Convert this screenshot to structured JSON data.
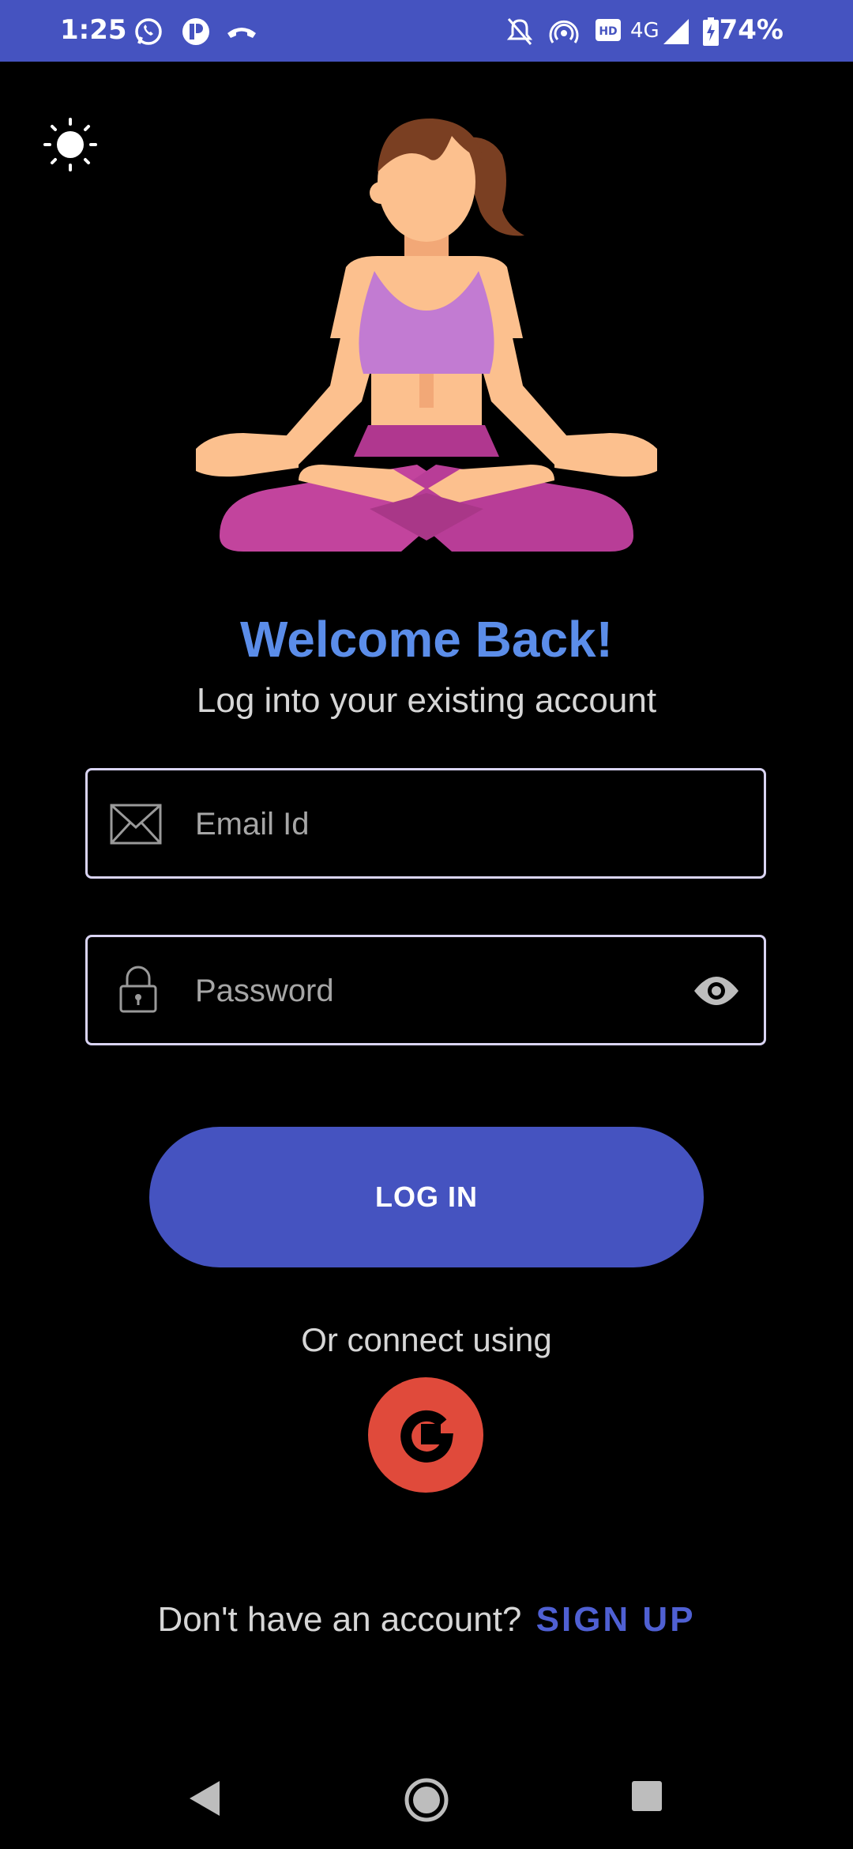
{
  "status_bar": {
    "time": "1:25",
    "network": "4G",
    "battery": "74%",
    "icons": [
      "whatsapp-icon",
      "app-icon",
      "missed-call-icon",
      "mute-icon",
      "hotspot-icon",
      "hd-icon",
      "signal-icon",
      "battery-icon"
    ]
  },
  "theme_toggle": {
    "icon": "sun-icon"
  },
  "header": {
    "title": "Welcome Back!",
    "subtitle": "Log into your existing account"
  },
  "form": {
    "email": {
      "placeholder": "Email Id",
      "value": "",
      "icon": "mail-icon"
    },
    "password": {
      "placeholder": "Password",
      "value": "",
      "icon": "lock-icon",
      "toggle_icon": "eye-icon"
    },
    "login_label": "LOG IN"
  },
  "social": {
    "label": "Or connect using",
    "google_icon": "google-icon"
  },
  "signup": {
    "prompt": "Don't have an account?",
    "link_label": "SIGN UP"
  },
  "colors": {
    "accent": "#4553c0",
    "title": "#5b8de9",
    "google": "#e04a3b",
    "background": "#000000"
  },
  "nav_bar": {
    "icons": [
      "back-icon",
      "home-icon",
      "recents-icon"
    ]
  }
}
